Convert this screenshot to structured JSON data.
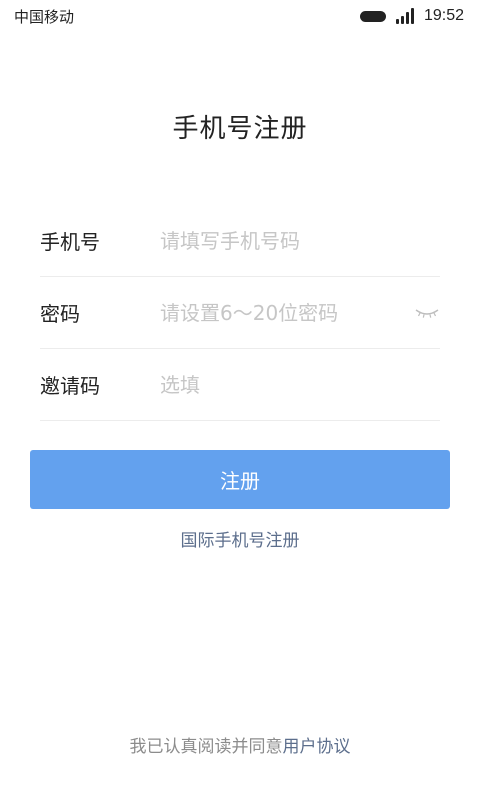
{
  "status_bar": {
    "carrier": "中国移动",
    "time": "19:52"
  },
  "page": {
    "title": "手机号注册"
  },
  "form": {
    "phone": {
      "label": "手机号",
      "placeholder": "请填写手机号码",
      "value": ""
    },
    "password": {
      "label": "密码",
      "placeholder": "请设置6～20位密码",
      "value": ""
    },
    "invite": {
      "label": "邀请码",
      "placeholder": "选填",
      "value": ""
    }
  },
  "actions": {
    "register_label": "注册",
    "intl_register_label": "国际手机号注册"
  },
  "footer": {
    "agreement_prefix": "我已认真阅读并同意",
    "agreement_link": "用户协议"
  },
  "colors": {
    "primary": "#63a1ee",
    "link": "#5c6e8c",
    "placeholder": "#c6c6c6"
  },
  "icons": {
    "password_toggle": "eye-closed-icon"
  }
}
